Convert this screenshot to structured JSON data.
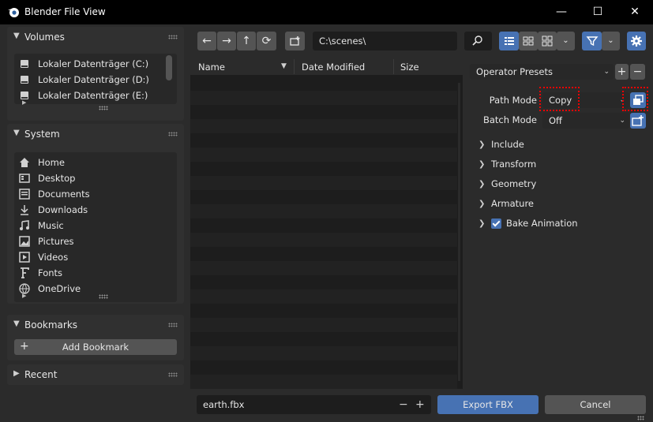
{
  "window": {
    "title": "Blender File View",
    "minimize": "—",
    "maximize": "☐",
    "close": "✕"
  },
  "sidebar": {
    "volumes": {
      "title": "Volumes",
      "items": [
        {
          "label": "Lokaler Datenträger (C:)",
          "icon": "drive-icon"
        },
        {
          "label": "Lokaler Datenträger (D:)",
          "icon": "drive-icon"
        },
        {
          "label": "Lokaler Datenträger (E:)",
          "icon": "drive-icon"
        }
      ]
    },
    "system": {
      "title": "System",
      "items": [
        {
          "label": "Home",
          "icon": "home-icon"
        },
        {
          "label": "Desktop",
          "icon": "desktop-icon"
        },
        {
          "label": "Documents",
          "icon": "documents-icon"
        },
        {
          "label": "Downloads",
          "icon": "downloads-icon"
        },
        {
          "label": "Music",
          "icon": "music-icon"
        },
        {
          "label": "Pictures",
          "icon": "pictures-icon"
        },
        {
          "label": "Videos",
          "icon": "videos-icon"
        },
        {
          "label": "Fonts",
          "icon": "fonts-icon"
        },
        {
          "label": "OneDrive",
          "icon": "onedrive-icon"
        }
      ]
    },
    "bookmarks": {
      "title": "Bookmarks",
      "add_label": "Add Bookmark"
    },
    "recent": {
      "title": "Recent"
    }
  },
  "toolbar": {
    "path": "C:\\scenes\\"
  },
  "filelist": {
    "columns": [
      "Name",
      "Date Modified",
      "Size"
    ]
  },
  "options": {
    "presets_label": "Operator Presets",
    "path_mode": {
      "label": "Path Mode",
      "value": "Copy"
    },
    "batch_mode": {
      "label": "Batch Mode",
      "value": "Off"
    },
    "sections": [
      {
        "label": "Include",
        "checkbox": false
      },
      {
        "label": "Transform",
        "checkbox": false
      },
      {
        "label": "Geometry",
        "checkbox": false
      },
      {
        "label": "Armature",
        "checkbox": false
      },
      {
        "label": "Bake Animation",
        "checkbox": true
      }
    ]
  },
  "bottom": {
    "filename": "earth.fbx",
    "export_label": "Export FBX",
    "cancel_label": "Cancel"
  },
  "colors": {
    "accent": "#4772b3",
    "highlight": "#e00000"
  }
}
